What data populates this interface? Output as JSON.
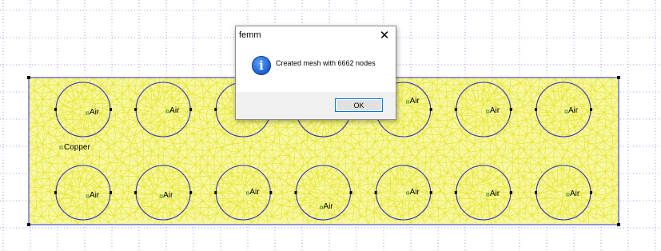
{
  "dialog": {
    "title": "femm",
    "close_glyph": "✕",
    "icon": "info-icon",
    "icon_glyph": "i",
    "message": "Created mesh with 6662 nodes",
    "ok_label": "OK"
  },
  "model": {
    "copper_label": "Copper",
    "air_label": "Air",
    "rows": 2,
    "cols": 7
  },
  "colors": {
    "mesh": "#e8e83a",
    "mesh_fill": "#f7f7a0",
    "boundary": "#2b2bd6",
    "node": "#000000",
    "label_marker": "#2a8a2a",
    "grid_dot": "#4a5ad0"
  }
}
